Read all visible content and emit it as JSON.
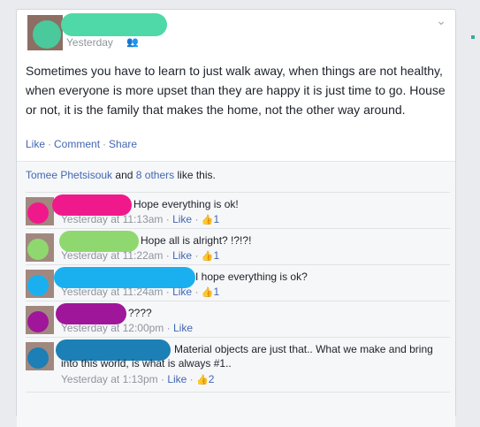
{
  "post": {
    "timestamp": "Yesterday",
    "text": "Sometimes you have to learn to just walk away, when things are not healthy, when everyone is more upset than they are happy it is just time to go. House or not, it is the family that makes the home, not the other way around.",
    "colors": {
      "name_blob": "#4fd9a8",
      "avatar_blob": "#49c99c"
    }
  },
  "actions": {
    "like": "Like",
    "comment": "Comment",
    "share": "Share",
    "separator": "·"
  },
  "likes": {
    "name": "Tomee Phetsisouk",
    "and": "and",
    "others": "8 others",
    "suffix": "like this."
  },
  "comments": [
    {
      "text": "Hope everything is ok!",
      "time": "Yesterday at 11:13am",
      "like": "Like",
      "count": "1",
      "color": "#f0198c"
    },
    {
      "text": "Hope all is alright? !?!?!",
      "time": "Yesterday at 11:22am",
      "like": "Like",
      "count": "1",
      "color": "#8fd86f"
    },
    {
      "text": "I hope everything is ok?",
      "time": "Yesterday at 11:24am",
      "like": "Like",
      "count": "1",
      "color": "#1ab0f0"
    },
    {
      "text": "????",
      "time": "Yesterday at 12:00pm",
      "like": "Like",
      "count": "",
      "color": "#a0169a"
    },
    {
      "text_line1": "Material objects are just that.. What we make and bring",
      "text_line2": "into this world, is what is always #1..",
      "time": "Yesterday at 1:13pm",
      "like": "Like",
      "count": "2",
      "color": "#1c7fb5"
    }
  ]
}
